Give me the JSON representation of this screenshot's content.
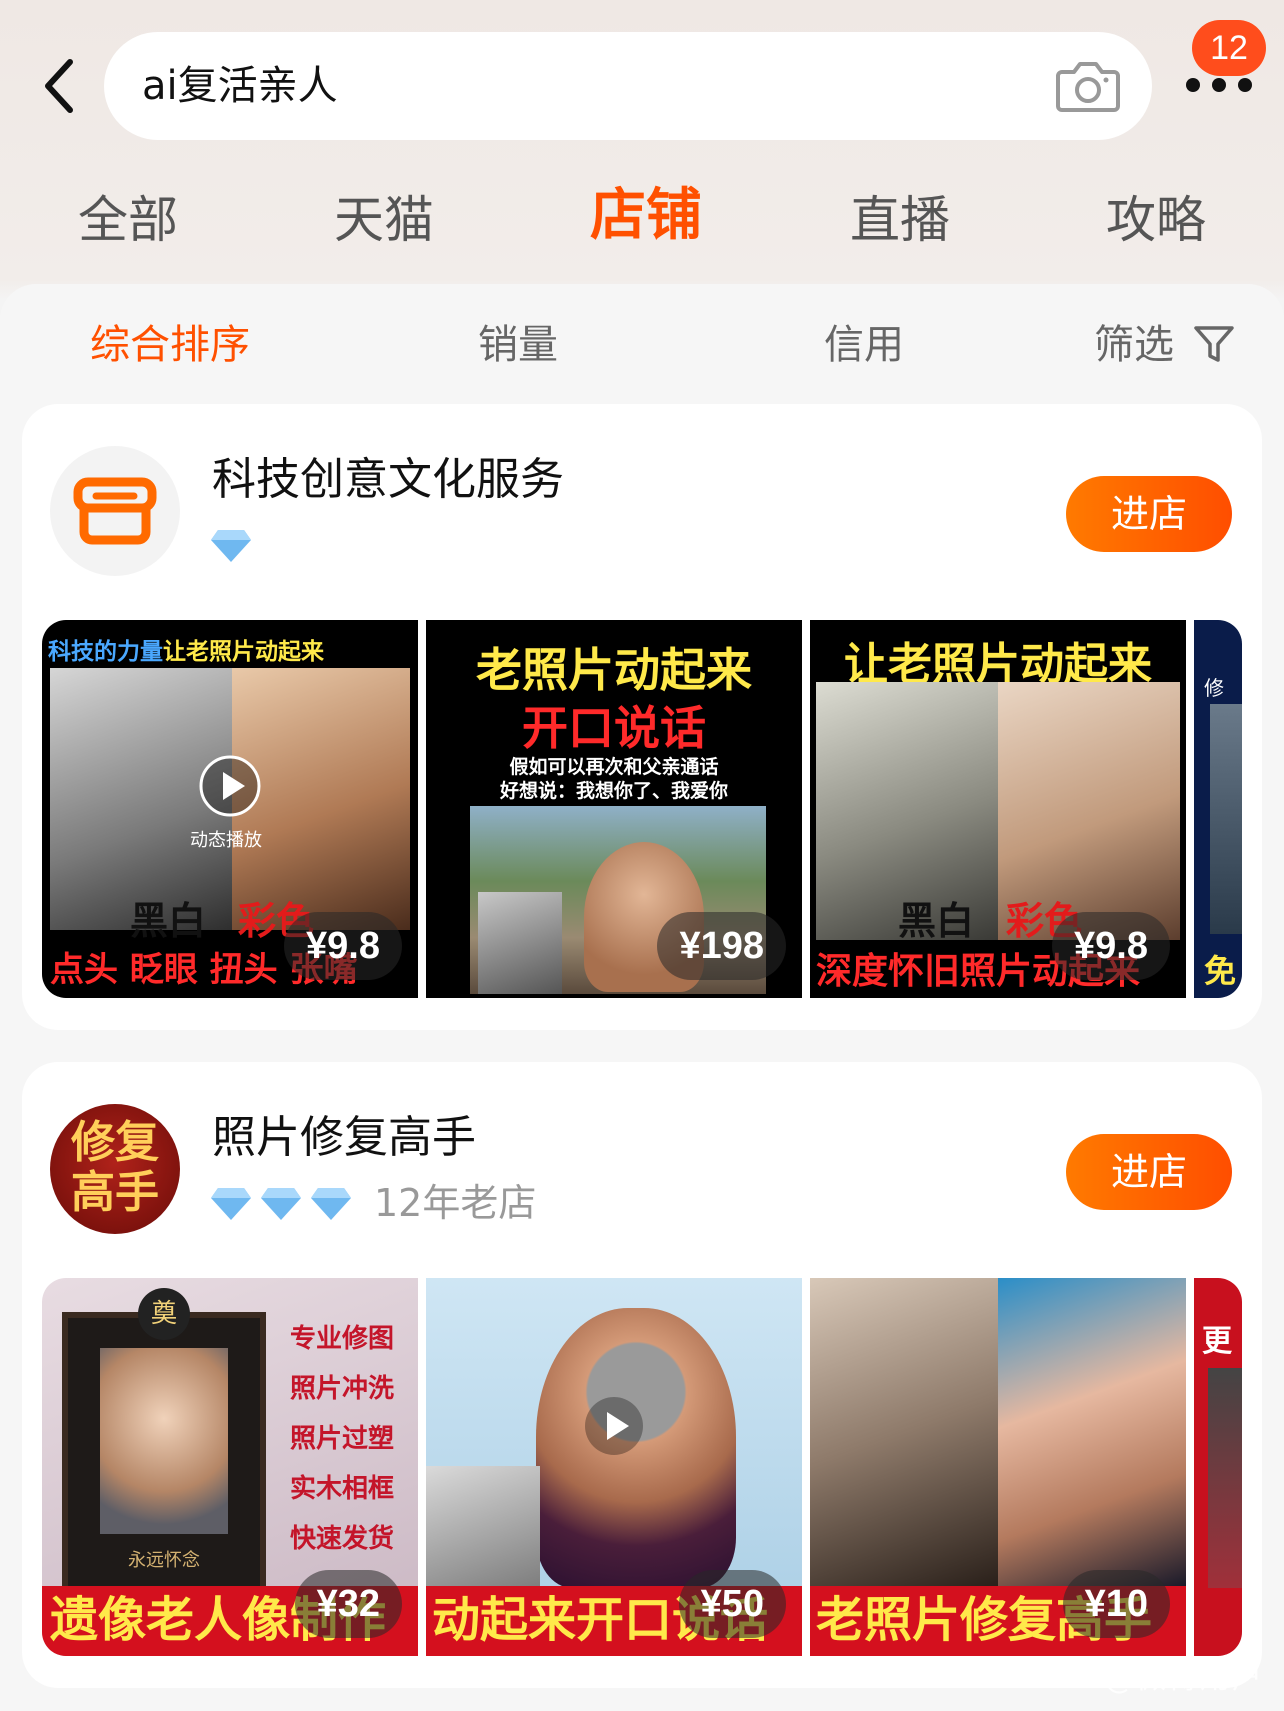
{
  "header": {
    "search_query": "ai复活亲人",
    "notification_count": "12"
  },
  "main_tabs": [
    "全部",
    "天猫",
    "店铺",
    "直播",
    "攻略"
  ],
  "sort_tabs": [
    "综合排序",
    "销量",
    "信用",
    "筛选"
  ],
  "stores": [
    {
      "name": "科技创意文化服务",
      "diamonds": 1,
      "enter_label": "进店",
      "products": [
        {
          "top_text_a": "科技的力量",
          "top_text_b": "让老照片动起来",
          "mid_label": "动态播放",
          "bw_label": "黑白",
          "color_label": "彩色",
          "bottom_text": "点头 眨眼 扭头 张嘴",
          "price": "¥9.8"
        },
        {
          "line1": "老照片动起来",
          "line2": "开口说话",
          "sub1": "假如可以再次和父亲通话",
          "sub2": "好想说：我想你了、我爱你",
          "price": "¥198"
        },
        {
          "top_text": "让老照片动起来",
          "bw_label": "黑白",
          "color_label": "彩色",
          "bottom_text": "深度怀旧照片动起来",
          "price": "¥9.8"
        },
        {
          "peek_text": "修",
          "peek_bottom": "免"
        }
      ]
    },
    {
      "name": "照片修复高手",
      "logo_text_1": "修复",
      "logo_text_2": "高手",
      "diamonds": 3,
      "age": "12年老店",
      "enter_label": "进店",
      "products": [
        {
          "services": [
            "专业修图",
            "照片冲洗",
            "照片过塑",
            "实木相框",
            "快速发货"
          ],
          "frame_caption": "永远怀念",
          "frame_badge": "奠",
          "bottom_text": "遗像老人像制作",
          "price": "¥32"
        },
        {
          "bottom_text": "动起来开口说话",
          "price": "¥50"
        },
        {
          "bottom_text": "老照片修复高手",
          "price": "¥10"
        },
        {
          "peek_text": "更"
        }
      ]
    }
  ],
  "watermark": "@微博用户",
  "colors": {
    "accent": "#ff5000",
    "enter_button": "#ff6a00"
  }
}
